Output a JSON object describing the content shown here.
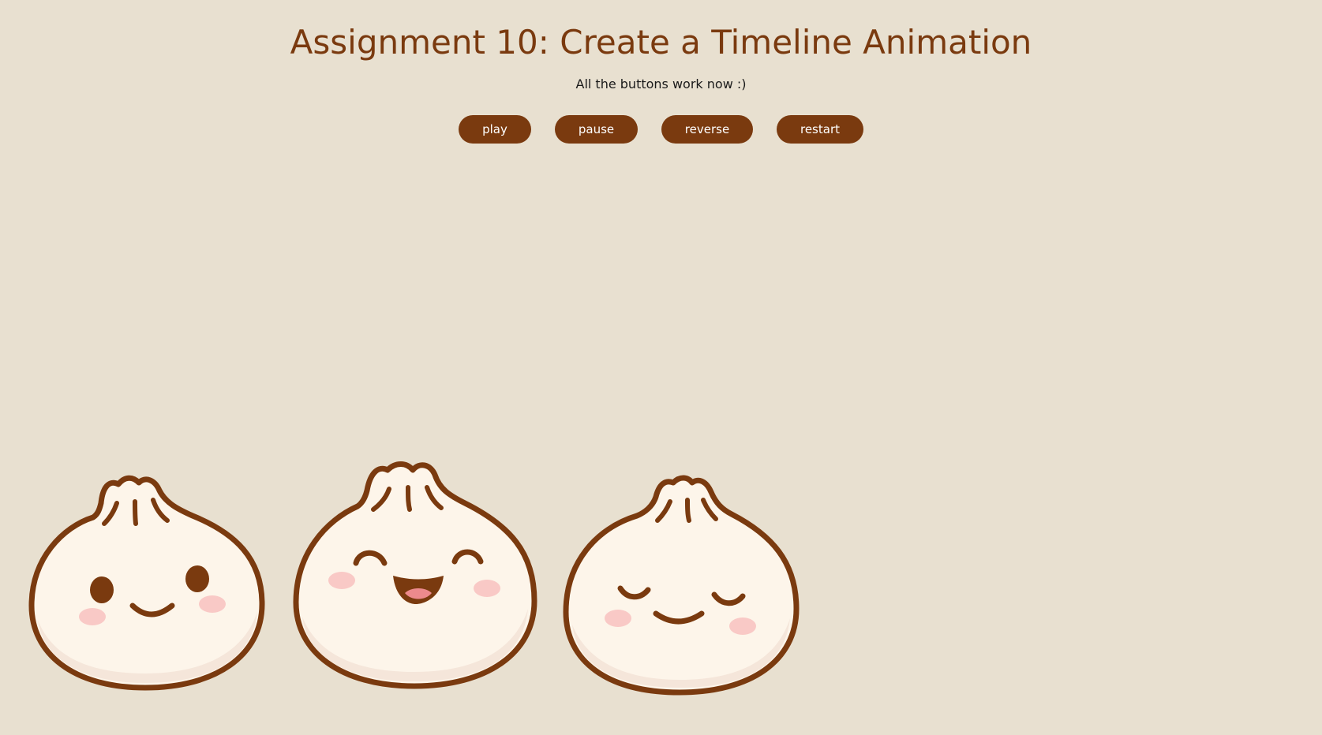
{
  "header": {
    "title": "Assignment 10: Create a Timeline Animation",
    "subtitle": "All the buttons work now :)"
  },
  "controls": {
    "play_label": "play",
    "pause_label": "pause",
    "reverse_label": "reverse",
    "restart_label": "restart"
  },
  "characters": [
    {
      "name": "bao-smiling",
      "icon": "bao-bun-smile-icon"
    },
    {
      "name": "bao-laughing",
      "icon": "bao-bun-laugh-icon"
    },
    {
      "name": "bao-content",
      "icon": "bao-bun-content-icon"
    }
  ],
  "colors": {
    "background": "#e8e0d0",
    "accent": "#7a3a0f",
    "bun": "#fdf5ea",
    "bun_shadow": "#f5e6da",
    "blush": "#f9c9c6",
    "tongue": "#ec8a8d"
  }
}
